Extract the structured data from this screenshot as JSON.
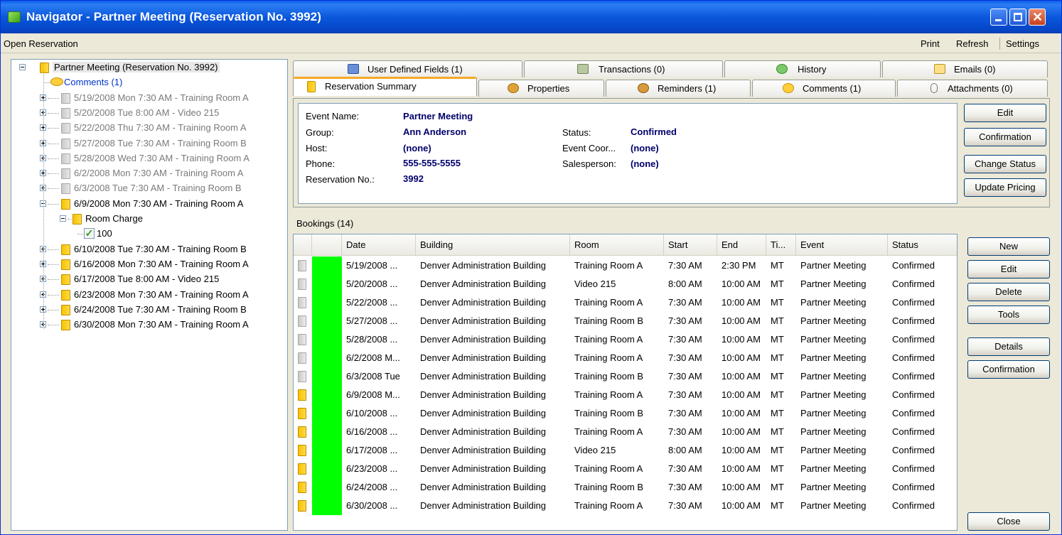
{
  "window": {
    "title": "Navigator - Partner Meeting (Reservation No. 3992)",
    "controls": [
      "minimize",
      "maximize",
      "close"
    ]
  },
  "menubar": {
    "left": "Open Reservation",
    "right": [
      "Print",
      "Refresh",
      "Settings"
    ]
  },
  "tree": {
    "root": "Partner Meeting (Reservation No. 3992)",
    "comments": "Comments (1)",
    "items_before": [
      "5/19/2008 Mon 7:30 AM - Training Room A",
      "5/20/2008 Tue 8:00 AM - Video 215",
      "5/22/2008 Thu 7:30 AM - Training Room A",
      "5/27/2008 Tue 7:30 AM - Training Room B",
      "5/28/2008 Wed 7:30 AM - Training Room A",
      "6/2/2008 Mon 7:30 AM - Training Room A",
      "6/3/2008 Tue 7:30 AM - Training Room B"
    ],
    "expanded_item": "6/9/2008 Mon 7:30 AM - Training Room A",
    "child": "Room Charge",
    "grandchild": "100",
    "items_after": [
      "6/10/2008 Tue 7:30 AM - Training Room B",
      "6/16/2008 Mon 7:30 AM - Training Room A",
      "6/17/2008 Tue 8:00 AM - Video 215",
      "6/23/2008 Mon 7:30 AM - Training Room A",
      "6/24/2008 Tue 7:30 AM - Training Room B",
      "6/30/2008 Mon 7:30 AM - Training Room A"
    ]
  },
  "tabs": {
    "row1": [
      {
        "label": "User Defined Fields (1)",
        "icon": "user-icon"
      },
      {
        "label": "Transactions (0)",
        "icon": "money-icon"
      },
      {
        "label": "History",
        "icon": "history-icon"
      },
      {
        "label": "Emails (0)",
        "icon": "email-icon"
      }
    ],
    "row2": [
      {
        "label": "Reservation Summary",
        "icon": "folder-icon",
        "active": true
      },
      {
        "label": "Properties",
        "icon": "gear-icon"
      },
      {
        "label": "Reminders (1)",
        "icon": "reminder-icon"
      },
      {
        "label": "Comments (1)",
        "icon": "comment-icon"
      },
      {
        "label": "Attachments (0)",
        "icon": "paperclip-icon"
      }
    ]
  },
  "summary": {
    "event_name_label": "Event Name:",
    "event_name": "Partner Meeting",
    "group_label": "Group:",
    "group": "Ann Anderson",
    "host_label": "Host:",
    "host": "(none)",
    "phone_label": "Phone:",
    "phone": "555-555-5555",
    "resno_label": "Reservation No.:",
    "resno": "3992",
    "status_label": "Status:",
    "status": "Confirmed",
    "coord_label": "Event Coor...",
    "coord": "(none)",
    "sales_label": "Salesperson:",
    "sales": "(none)"
  },
  "summary_buttons": [
    "Edit",
    "Confirmation",
    "Change Status",
    "Update Pricing"
  ],
  "bookings": {
    "label": "Bookings (14)",
    "columns": [
      "Date",
      "Building",
      "Room",
      "Start",
      "End",
      "Ti...",
      "Event",
      "Status"
    ],
    "rows": [
      {
        "icon": "gray",
        "cells": [
          "5/19/2008 ...",
          "Denver Administration Building",
          "Training Room A",
          "7:30 AM",
          "2:30 PM",
          "MT",
          "Partner Meeting",
          "Confirmed"
        ]
      },
      {
        "icon": "gray",
        "cells": [
          "5/20/2008 ...",
          "Denver Administration Building",
          "Video 215",
          "8:00 AM",
          "10:00 AM",
          "MT",
          "Partner Meeting",
          "Confirmed"
        ]
      },
      {
        "icon": "gray",
        "cells": [
          "5/22/2008 ...",
          "Denver Administration Building",
          "Training Room A",
          "7:30 AM",
          "10:00 AM",
          "MT",
          "Partner Meeting",
          "Confirmed"
        ]
      },
      {
        "icon": "gray",
        "cells": [
          "5/27/2008 ...",
          "Denver Administration Building",
          "Training Room B",
          "7:30 AM",
          "10:00 AM",
          "MT",
          "Partner Meeting",
          "Confirmed"
        ]
      },
      {
        "icon": "gray",
        "cells": [
          "5/28/2008 ...",
          "Denver Administration Building",
          "Training Room A",
          "7:30 AM",
          "10:00 AM",
          "MT",
          "Partner Meeting",
          "Confirmed"
        ]
      },
      {
        "icon": "gray",
        "cells": [
          "6/2/2008 M...",
          "Denver Administration Building",
          "Training Room A",
          "7:30 AM",
          "10:00 AM",
          "MT",
          "Partner Meeting",
          "Confirmed"
        ]
      },
      {
        "icon": "gray",
        "cells": [
          "6/3/2008 Tue",
          "Denver Administration Building",
          "Training Room B",
          "7:30 AM",
          "10:00 AM",
          "MT",
          "Partner Meeting",
          "Confirmed"
        ]
      },
      {
        "icon": "yellow",
        "cells": [
          "6/9/2008 M...",
          "Denver Administration Building",
          "Training Room A",
          "7:30 AM",
          "10:00 AM",
          "MT",
          "Partner Meeting",
          "Confirmed"
        ]
      },
      {
        "icon": "yellow",
        "cells": [
          "6/10/2008 ...",
          "Denver Administration Building",
          "Training Room B",
          "7:30 AM",
          "10:00 AM",
          "MT",
          "Partner Meeting",
          "Confirmed"
        ]
      },
      {
        "icon": "yellow",
        "cells": [
          "6/16/2008 ...",
          "Denver Administration Building",
          "Training Room A",
          "7:30 AM",
          "10:00 AM",
          "MT",
          "Partner Meeting",
          "Confirmed"
        ]
      },
      {
        "icon": "yellow",
        "cells": [
          "6/17/2008 ...",
          "Denver Administration Building",
          "Video 215",
          "8:00 AM",
          "10:00 AM",
          "MT",
          "Partner Meeting",
          "Confirmed"
        ]
      },
      {
        "icon": "yellow",
        "cells": [
          "6/23/2008 ...",
          "Denver Administration Building",
          "Training Room A",
          "7:30 AM",
          "10:00 AM",
          "MT",
          "Partner Meeting",
          "Confirmed"
        ]
      },
      {
        "icon": "yellow",
        "cells": [
          "6/24/2008 ...",
          "Denver Administration Building",
          "Training Room B",
          "7:30 AM",
          "10:00 AM",
          "MT",
          "Partner Meeting",
          "Confirmed"
        ]
      },
      {
        "icon": "yellow",
        "cells": [
          "6/30/2008 ...",
          "Denver Administration Building",
          "Training Room A",
          "7:30 AM",
          "10:00 AM",
          "MT",
          "Partner Meeting",
          "Confirmed"
        ]
      }
    ]
  },
  "booking_buttons": [
    "New",
    "Edit",
    "Delete",
    "Tools",
    "Details",
    "Confirmation"
  ],
  "close_button": "Close",
  "colors": {
    "status_bar": "#00ff00",
    "title_bar": "#0a5fe8",
    "accent_tab": "#f5a92a"
  }
}
